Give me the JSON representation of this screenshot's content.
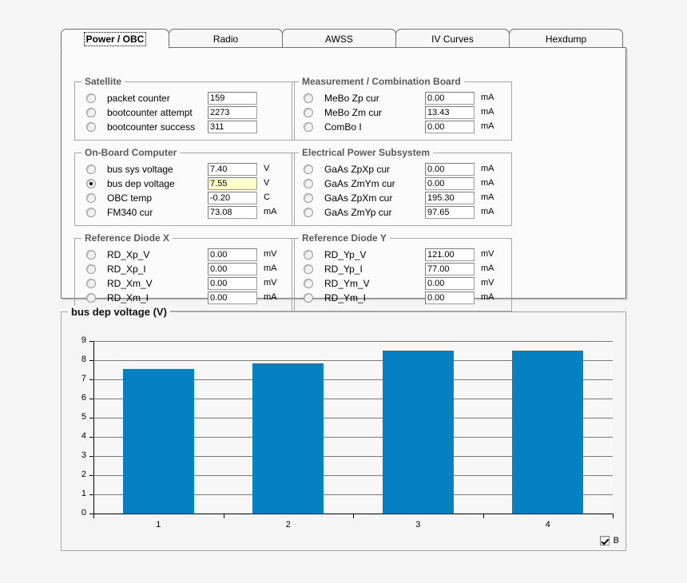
{
  "tabs": [
    {
      "label": "Power / OBC",
      "active": true
    },
    {
      "label": "Radio",
      "active": false
    },
    {
      "label": "AWSS",
      "active": false
    },
    {
      "label": "IV Curves",
      "active": false
    },
    {
      "label": "Hexdump",
      "active": false
    }
  ],
  "groups": {
    "satellite": {
      "title": "Satellite",
      "rows": [
        {
          "label": "packet counter",
          "value": "159",
          "unit": "",
          "selected": false,
          "highlight": false
        },
        {
          "label": "bootcounter attempt",
          "value": "2273",
          "unit": "",
          "selected": false,
          "highlight": false
        },
        {
          "label": "bootcounter success",
          "value": "311",
          "unit": "",
          "selected": false,
          "highlight": false
        }
      ]
    },
    "obc": {
      "title": "On-Board Computer",
      "rows": [
        {
          "label": "bus sys voltage",
          "value": "7.40",
          "unit": "V",
          "selected": false,
          "highlight": false
        },
        {
          "label": "bus dep voltage",
          "value": "7.55",
          "unit": "V",
          "selected": true,
          "highlight": true
        },
        {
          "label": "OBC temp",
          "value": "-0.20",
          "unit": "C",
          "selected": false,
          "highlight": false
        },
        {
          "label": "FM340 cur",
          "value": "73.08",
          "unit": "mA",
          "selected": false,
          "highlight": false
        }
      ]
    },
    "refdiodex": {
      "title": "Reference Diode X",
      "rows": [
        {
          "label": "RD_Xp_V",
          "value": "0.00",
          "unit": "mV",
          "selected": false,
          "highlight": false
        },
        {
          "label": "RD_Xp_I",
          "value": "0.00",
          "unit": "mA",
          "selected": false,
          "highlight": false
        },
        {
          "label": "RD_Xm_V",
          "value": "0.00",
          "unit": "mV",
          "selected": false,
          "highlight": false
        },
        {
          "label": "RD_Xm_I",
          "value": "0.00",
          "unit": "mA",
          "selected": false,
          "highlight": false
        }
      ]
    },
    "mebo": {
      "title": "Measurement / Combination Board",
      "rows": [
        {
          "label": "MeBo Zp cur",
          "value": "0.00",
          "unit": "mA",
          "selected": false,
          "highlight": false
        },
        {
          "label": "MeBo Zm cur",
          "value": "13.43",
          "unit": "mA",
          "selected": false,
          "highlight": false
        },
        {
          "label": "ComBo I",
          "value": "0.00",
          "unit": "mA",
          "selected": false,
          "highlight": false
        }
      ]
    },
    "eps": {
      "title": "Electrical Power Subsystem",
      "rows": [
        {
          "label": "GaAs ZpXp cur",
          "value": "0.00",
          "unit": "mA",
          "selected": false,
          "highlight": false
        },
        {
          "label": "GaAs ZmYm cur",
          "value": "0.00",
          "unit": "mA",
          "selected": false,
          "highlight": false
        },
        {
          "label": "GaAs ZpXm cur",
          "value": "195.30",
          "unit": "mA",
          "selected": false,
          "highlight": false
        },
        {
          "label": "GaAs ZmYp cur",
          "value": "97.65",
          "unit": "mA",
          "selected": false,
          "highlight": false
        }
      ]
    },
    "refdiodey": {
      "title": "Reference Diode Y",
      "rows": [
        {
          "label": "RD_Yp_V",
          "value": "121.00",
          "unit": "mV",
          "selected": false,
          "highlight": false
        },
        {
          "label": "RD_Yp_I",
          "value": "77.00",
          "unit": "mA",
          "selected": false,
          "highlight": false
        },
        {
          "label": "RD_Ym_V",
          "value": "0.00",
          "unit": "mV",
          "selected": false,
          "highlight": false
        },
        {
          "label": "RD_Ym_I",
          "value": "0.00",
          "unit": "mA",
          "selected": false,
          "highlight": false
        }
      ]
    }
  },
  "chart_panel": {
    "title": "bus dep voltage (V)",
    "legend": {
      "label": "B",
      "checked": true
    }
  },
  "chart_data": {
    "type": "bar",
    "title": "bus dep voltage (V)",
    "xlabel": "",
    "ylabel": "",
    "categories": [
      "1",
      "2",
      "3",
      "4"
    ],
    "values": [
      7.55,
      7.85,
      8.5,
      8.5
    ],
    "ylim": [
      0,
      9
    ],
    "yticks": [
      0,
      1,
      2,
      3,
      4,
      5,
      6,
      7,
      8,
      9
    ],
    "grid": true,
    "series_name": "B",
    "bar_color": "#0580c2",
    "legend_position": "bottom-right"
  },
  "colors": {
    "bar": "#0580c2",
    "highlight_field": "#ffffcc",
    "window_bg": "#f5f5f5",
    "panel_bg": "#fbfbfb"
  }
}
